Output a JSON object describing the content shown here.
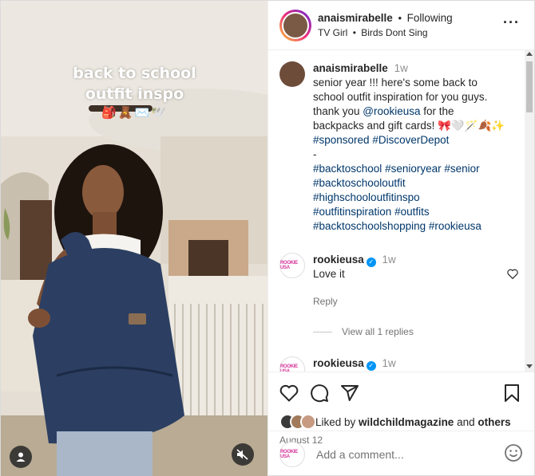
{
  "media": {
    "overlay_line1": "back to school",
    "overlay_line2": "outfit inspo",
    "overlay_emoji": "🎒🧸✉️🕊️",
    "user_tag_icon": "user-icon",
    "mute_icon": "speaker-muted-icon"
  },
  "header": {
    "username": "anaismirabelle",
    "separator": "•",
    "follow_status": "Following",
    "music_artist": "TV Girl",
    "music_track": "Birds Dont Sing",
    "more_icon": "more-horizontal-icon"
  },
  "caption": {
    "username": "anaismirabelle",
    "time": "1w",
    "lines": [
      "senior year !!! here's some back to",
      "school outfit inspiration for you guys.",
      "thank you ",
      "backpacks and gift cards! ",
      "-"
    ],
    "mention": "@rookieusa",
    "mention_suffix": " for the",
    "emoji_tail": "🎀🤍🪄🍂✨",
    "hashtags_1": [
      "#sponsored",
      "#DiscoverDepot"
    ],
    "hashtags_2": [
      "#backtoschool",
      "#senioryear",
      "#senior"
    ],
    "hashtags_3": [
      "#backtoschooloutfit"
    ],
    "hashtags_4": [
      "#highschooloutfitinspo"
    ],
    "hashtags_5": [
      "#outfitinspiration",
      "#outfits"
    ],
    "hashtags_6": [
      "#backtoschoolshopping",
      "#rookieusa"
    ]
  },
  "comments": [
    {
      "username": "rookieusa",
      "avatar_text": "ROOKIE USA",
      "time": "1w",
      "text": "Love it",
      "reply_label": "Reply",
      "view_replies": "View all 1 replies"
    },
    {
      "username": "rookieusa",
      "avatar_text": "ROOKIE USA",
      "time": "1w"
    }
  ],
  "actions": {
    "like_icon": "heart-icon",
    "comment_icon": "comment-icon",
    "share_icon": "send-icon",
    "save_icon": "bookmark-icon",
    "liked_by_prefix": "Liked by ",
    "liked_by_user": "wildchildmagazine",
    "liked_by_and": " and ",
    "liked_by_others": "others",
    "date": "August 12"
  },
  "add_comment": {
    "placeholder": "Add a comment...",
    "avatar_text": "ROOKIE USA",
    "emoji_icon": "smiley-icon"
  },
  "colors": {
    "link": "#00376b",
    "verified": "#0095f6",
    "muted_text": "#737373",
    "brand_pink": "#d6339a"
  }
}
